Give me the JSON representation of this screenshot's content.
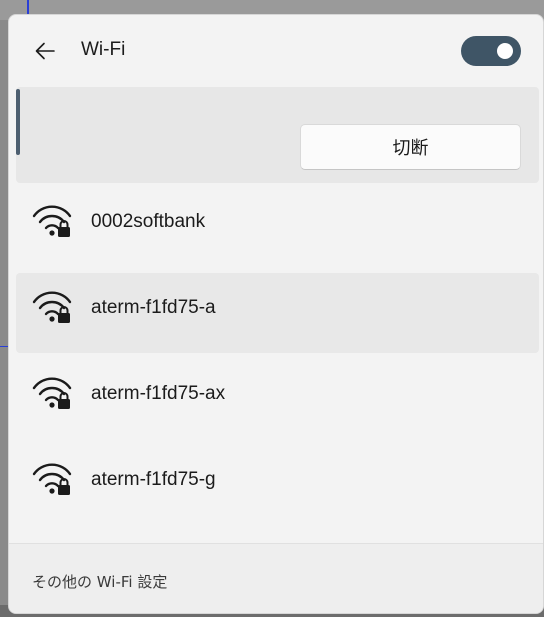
{
  "header": {
    "back_icon": "arrow-left-icon",
    "title": "Wi-Fi",
    "toggle_state": "on",
    "toggle_color": "#3f5566"
  },
  "connected": {
    "disconnect_label": "切断"
  },
  "networks": [
    {
      "name": "0002softbank",
      "icon": "wifi-secured-icon"
    },
    {
      "name": "aterm-f1fd75-a",
      "icon": "wifi-secured-icon"
    },
    {
      "name": "aterm-f1fd75-ax",
      "icon": "wifi-secured-icon"
    },
    {
      "name": "aterm-f1fd75-g",
      "icon": "wifi-secured-icon"
    }
  ],
  "footer": {
    "more_settings": "その他の Wi-Fi 設定"
  }
}
